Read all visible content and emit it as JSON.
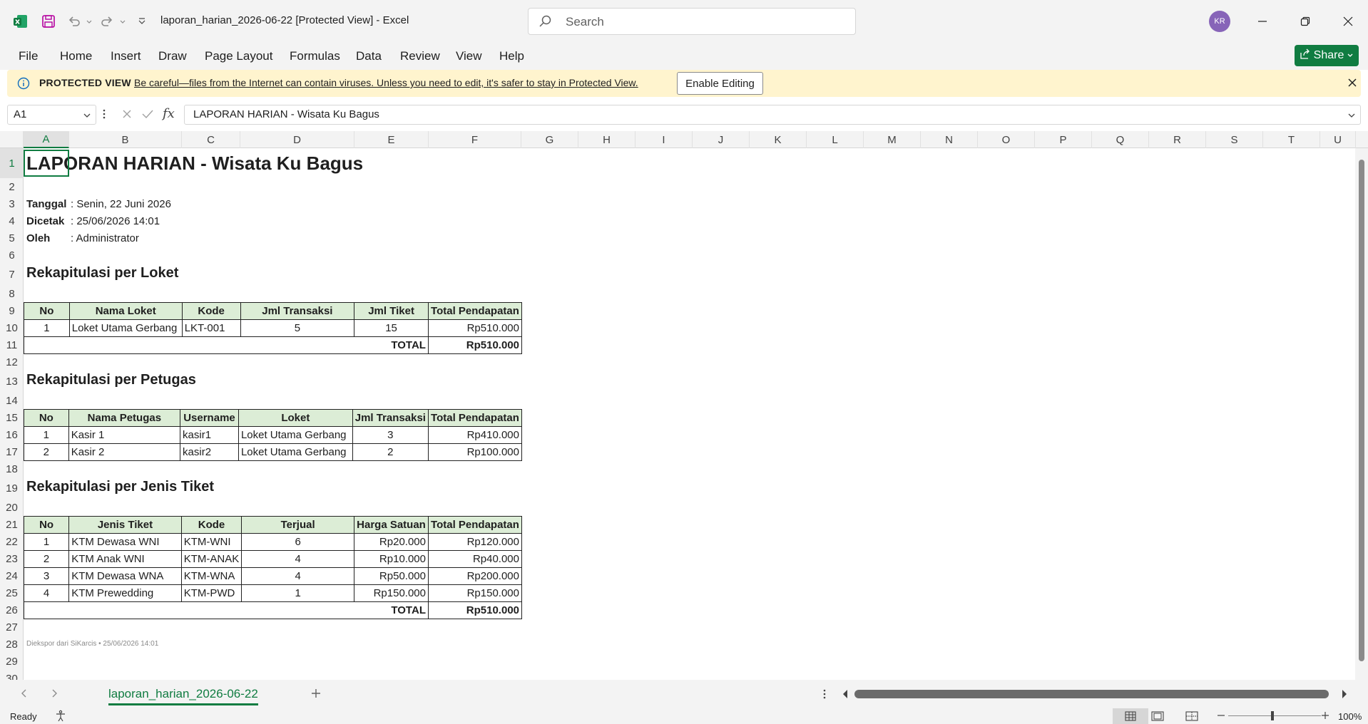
{
  "titlebar": {
    "doc_title": "laporan_harian_2026-06-22  [Protected View]  -  Excel",
    "search_placeholder": "Search",
    "avatar_initials": "KR"
  },
  "menu": {
    "items": [
      "File",
      "Home",
      "Insert",
      "Draw",
      "Page Layout",
      "Formulas",
      "Data",
      "Review",
      "View",
      "Help"
    ],
    "share_label": "Share"
  },
  "protected_view": {
    "title": "PROTECTED VIEW",
    "message": "Be careful—files from the Internet can contain viruses. Unless you need to edit, it's safer to stay in Protected View.",
    "button": "Enable Editing"
  },
  "formula_bar": {
    "name_box": "A1",
    "fx": "fx",
    "content": "LAPORAN HARIAN - Wisata Ku Bagus"
  },
  "grid": {
    "columns": [
      "A",
      "B",
      "C",
      "D",
      "E",
      "F",
      "G",
      "H",
      "I",
      "J",
      "K",
      "L",
      "M",
      "N",
      "O",
      "P",
      "Q",
      "R",
      "S",
      "T",
      "U"
    ],
    "rows": [
      "1",
      "2",
      "3",
      "4",
      "5",
      "6",
      "7",
      "8",
      "9",
      "10",
      "11",
      "12",
      "13",
      "14",
      "15",
      "16",
      "17",
      "18",
      "19",
      "20",
      "21",
      "22",
      "23",
      "24",
      "25",
      "26",
      "27",
      "28",
      "29",
      "30"
    ]
  },
  "report": {
    "title": "LAPORAN HARIAN - Wisata Ku Bagus",
    "meta": [
      {
        "label": "Tanggal",
        "value": ": Senin, 22 Juni 2026"
      },
      {
        "label": "Dicetak",
        "value": ": 25/06/2026 14:01"
      },
      {
        "label": "Oleh",
        "value": ": Administrator"
      }
    ],
    "loket": {
      "title": "Rekapitulasi per Loket",
      "headers": [
        "No",
        "Nama Loket",
        "Kode",
        "Jml Transaksi",
        "Jml Tiket",
        "Total Pendapatan"
      ],
      "rows": [
        [
          "1",
          "Loket Utama Gerbang",
          "LKT-001",
          "5",
          "15",
          "Rp510.000"
        ]
      ],
      "total_label": "TOTAL",
      "total_value": "Rp510.000"
    },
    "petugas": {
      "title": "Rekapitulasi per Petugas",
      "headers": [
        "No",
        "Nama Petugas",
        "Username",
        "Loket",
        "Jml Transaksi",
        "Total Pendapatan"
      ],
      "rows": [
        [
          "1",
          "Kasir 1",
          "kasir1",
          "Loket Utama Gerbang",
          "3",
          "Rp410.000"
        ],
        [
          "2",
          "Kasir 2",
          "kasir2",
          "Loket Utama Gerbang",
          "2",
          "Rp100.000"
        ]
      ]
    },
    "tiket": {
      "title": "Rekapitulasi per Jenis Tiket",
      "headers": [
        "No",
        "Jenis Tiket",
        "Kode",
        "Terjual",
        "Harga Satuan",
        "Total Pendapatan"
      ],
      "rows": [
        [
          "1",
          "KTM Dewasa WNI",
          "KTM-WNI",
          "6",
          "Rp20.000",
          "Rp120.000"
        ],
        [
          "2",
          "KTM Anak WNI",
          "KTM-ANAK",
          "4",
          "Rp10.000",
          "Rp40.000"
        ],
        [
          "3",
          "KTM Dewasa WNA",
          "KTM-WNA",
          "4",
          "Rp50.000",
          "Rp200.000"
        ],
        [
          "4",
          "KTM Prewedding",
          "KTM-PWD",
          "1",
          "Rp150.000",
          "Rp150.000"
        ]
      ],
      "total_label": "TOTAL",
      "total_value": "Rp510.000"
    },
    "footer_note": "Diekspor dari SiKarcis • 25/06/2026 14:01"
  },
  "sheet_tabs": {
    "active": "laporan_harian_2026-06-22"
  },
  "status": {
    "text": "Ready",
    "zoom": "100%"
  },
  "colors": {
    "accent": "#107c41",
    "header_fill": "#dcedd6",
    "protected_bg": "#fff4ce",
    "avatar": "#8764b8"
  }
}
